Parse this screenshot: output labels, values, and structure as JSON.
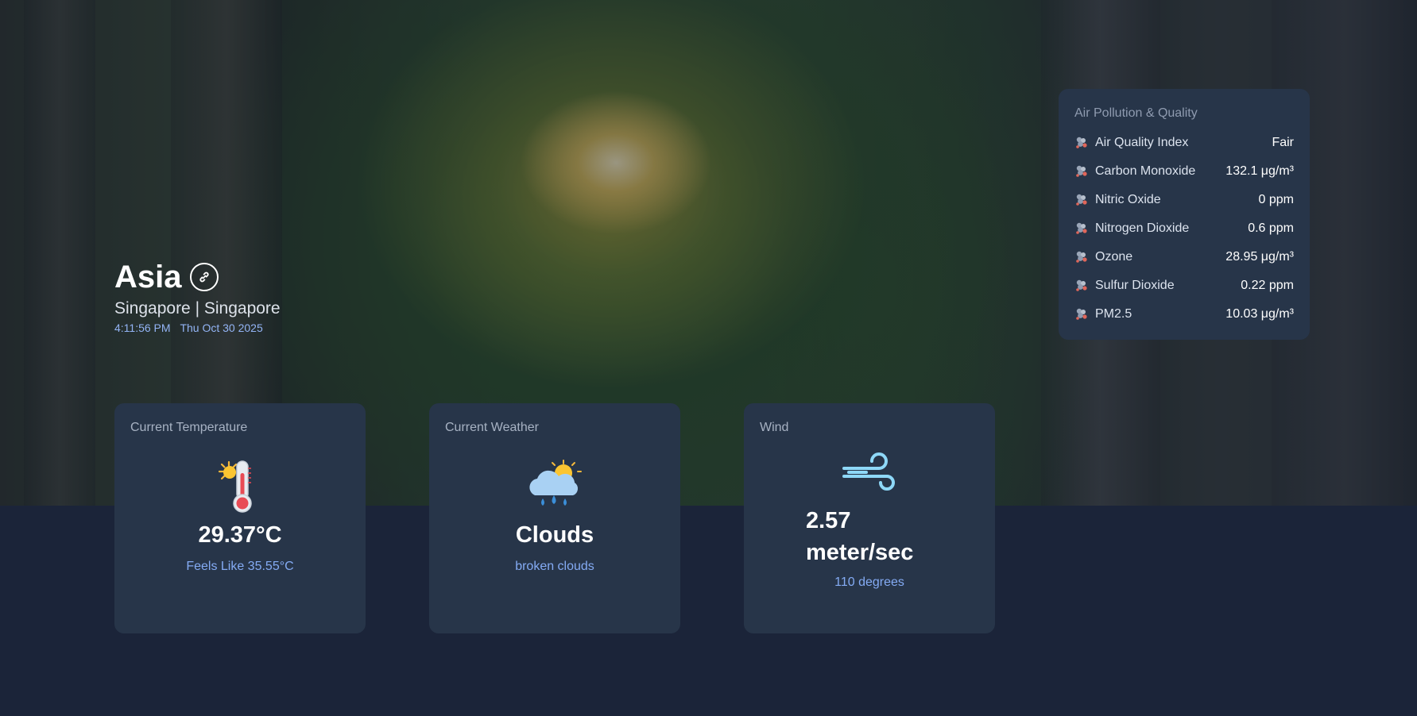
{
  "location": {
    "region": "Asia",
    "city_line": "Singapore | Singapore",
    "time": "4:11:56 PM",
    "date": "Thu Oct 30 2025"
  },
  "cards": {
    "temperature": {
      "label": "Current Temperature",
      "value": "29.37°C",
      "feels_like": "Feels Like 35.55°C",
      "icon": "thermometer-sun-icon"
    },
    "weather": {
      "label": "Current Weather",
      "value": "Clouds",
      "description": "broken clouds",
      "icon": "cloud-sun-rain-icon"
    },
    "wind": {
      "label": "Wind",
      "speed": "2.57",
      "unit": "meter/sec",
      "direction": "110 degrees",
      "icon": "wind-icon"
    }
  },
  "air_quality": {
    "title": "Air Pollution & Quality",
    "icon": "smog-icon",
    "items": [
      {
        "name": "Air Quality Index",
        "value": "Fair"
      },
      {
        "name": "Carbon Monoxide",
        "value": "132.1 μg/m³"
      },
      {
        "name": "Nitric Oxide",
        "value": "0 ppm"
      },
      {
        "name": "Nitrogen Dioxide",
        "value": "0.6 ppm"
      },
      {
        "name": "Ozone",
        "value": "28.95 μg/m³"
      },
      {
        "name": "Sulfur Dioxide",
        "value": "0.22 ppm"
      },
      {
        "name": "PM2.5",
        "value": "10.03 μg/m³"
      }
    ]
  },
  "colors": {
    "page_background": "#1b2439",
    "card_background": "#273549",
    "accent_text": "#84abf4",
    "label_text": "#a7b2c3"
  }
}
